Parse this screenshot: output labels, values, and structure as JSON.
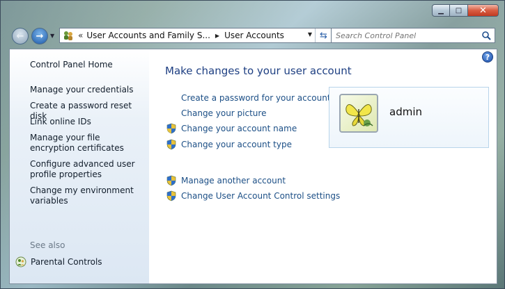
{
  "window": {
    "minimize_glyph": "▁",
    "maximize_glyph": "□",
    "close_glyph": "✕"
  },
  "navigation": {
    "back_glyph": "←",
    "forward_glyph": "→",
    "history_glyph": "▼",
    "address_separator": "«",
    "breadcrumbs": [
      "User Accounts and Family S...",
      "User Accounts"
    ],
    "crumb_arrow": "▶",
    "dropdown_glyph": "▼",
    "refresh_glyph": "⇆"
  },
  "search": {
    "placeholder": "Search Control Panel"
  },
  "sidebar": {
    "items": [
      {
        "label": "Control Panel Home"
      },
      {
        "label": "Manage your credentials"
      },
      {
        "label": "Create a password reset disk"
      },
      {
        "label": "Link online IDs"
      },
      {
        "label": "Manage your file encryption certificates"
      },
      {
        "label": "Configure advanced user profile properties"
      },
      {
        "label": "Change my environment variables"
      }
    ],
    "see_also_label": "See also",
    "see_also_items": [
      {
        "label": "Parental Controls"
      }
    ]
  },
  "main": {
    "title": "Make changes to your user account",
    "tasks": [
      {
        "label": "Create a password for your account",
        "shield": false
      },
      {
        "label": "Change your picture",
        "shield": false
      },
      {
        "label": "Change your account name",
        "shield": true
      },
      {
        "label": "Change your account type",
        "shield": true
      }
    ],
    "other_tasks": [
      {
        "label": "Manage another account",
        "shield": true
      },
      {
        "label": "Change User Account Control settings",
        "shield": true
      }
    ]
  },
  "user": {
    "name": "admin"
  },
  "help": {
    "glyph": "?"
  },
  "colors": {
    "link": "#1c4f86",
    "title": "#1e3f82",
    "sidebar_text": "#111d2b",
    "see_also": "#6c7a88"
  }
}
